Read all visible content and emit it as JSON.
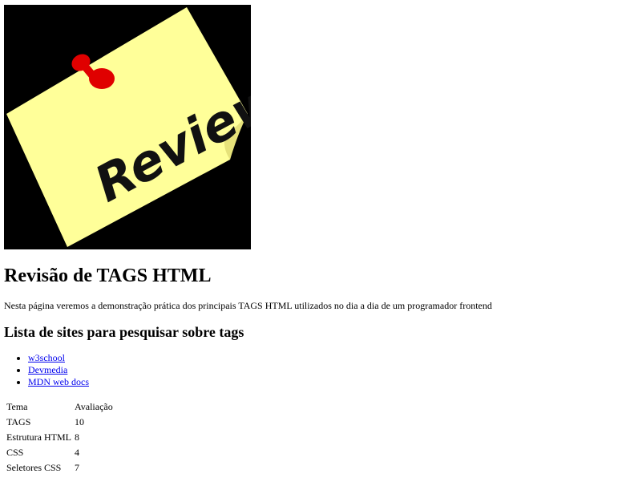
{
  "hero_image": {
    "text": "Review",
    "colors": {
      "background": "#000000",
      "note": "#ffff99",
      "fold": "#e6e27a",
      "pin": "#e00000",
      "ink": "#111111"
    }
  },
  "page": {
    "title": "Revisão de TAGS HTML",
    "intro": "Nesta página veremos a demonstração prática dos principais TAGS HTML utilizados no dia a dia de um programador frontend",
    "links_heading": "Lista de sites para pesquisar sobre tags"
  },
  "links": [
    {
      "label": "w3school"
    },
    {
      "label": "Devmedia"
    },
    {
      "label": "MDN web docs"
    }
  ],
  "table": {
    "headers": [
      "Tema",
      "Avaliação"
    ],
    "rows": [
      [
        "TAGS",
        "10"
      ],
      [
        "Estrutura HTML",
        "8"
      ],
      [
        "CSS",
        "4"
      ],
      [
        "Seletores CSS",
        "7"
      ]
    ]
  }
}
